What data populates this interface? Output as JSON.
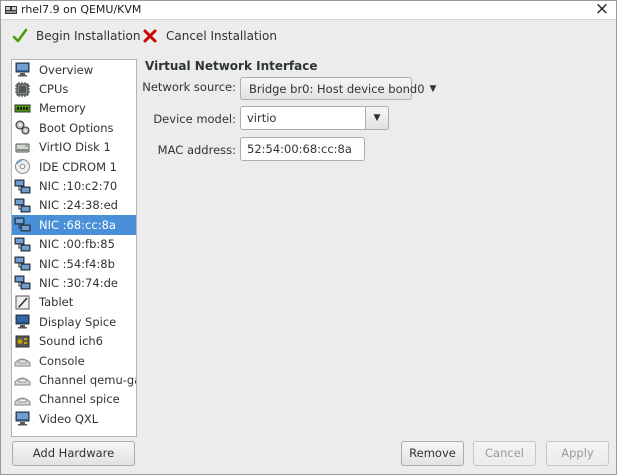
{
  "window": {
    "title": "rhel7.9 on QEMU/KVM"
  },
  "toolbar": {
    "begin_label": "Begin Installation",
    "cancel_label": "Cancel Installation"
  },
  "sidebar": {
    "items": [
      {
        "label": "Overview",
        "icon": "monitor-icon"
      },
      {
        "label": "CPUs",
        "icon": "cpu-icon"
      },
      {
        "label": "Memory",
        "icon": "memory-icon"
      },
      {
        "label": "Boot Options",
        "icon": "gears-icon"
      },
      {
        "label": "VirtIO Disk 1",
        "icon": "disk-icon"
      },
      {
        "label": "IDE CDROM 1",
        "icon": "cdrom-icon"
      },
      {
        "label": "NIC :10:c2:70",
        "icon": "nic-icon"
      },
      {
        "label": "NIC :24:38:ed",
        "icon": "nic-icon"
      },
      {
        "label": "NIC :68:cc:8a",
        "icon": "nic-icon",
        "selected": true
      },
      {
        "label": "NIC :00:fb:85",
        "icon": "nic-icon"
      },
      {
        "label": "NIC :54:f4:8b",
        "icon": "nic-icon"
      },
      {
        "label": "NIC :30:74:de",
        "icon": "nic-icon"
      },
      {
        "label": "Tablet",
        "icon": "tablet-icon"
      },
      {
        "label": "Display Spice",
        "icon": "display-icon"
      },
      {
        "label": "Sound ich6",
        "icon": "sound-icon"
      },
      {
        "label": "Console",
        "icon": "console-icon"
      },
      {
        "label": "Channel qemu-ga",
        "icon": "channel-icon"
      },
      {
        "label": "Channel spice",
        "icon": "channel-icon"
      },
      {
        "label": "Video QXL",
        "icon": "video-icon"
      }
    ]
  },
  "details": {
    "section_title": "Virtual Network Interface",
    "network_source_label": "Network source:",
    "network_source_value": "Bridge br0: Host device bond0",
    "device_model_label": "Device model:",
    "device_model_value": "virtio",
    "mac_label": "MAC address:",
    "mac_value": "52:54:00:68:cc:8a"
  },
  "buttons": {
    "add_hardware": "Add Hardware",
    "remove": "Remove",
    "cancel": "Cancel",
    "apply": "Apply"
  },
  "colors": {
    "selection": "#4a90d9",
    "begin_check": "#4e9a06",
    "cancel_x": "#cc0000"
  }
}
